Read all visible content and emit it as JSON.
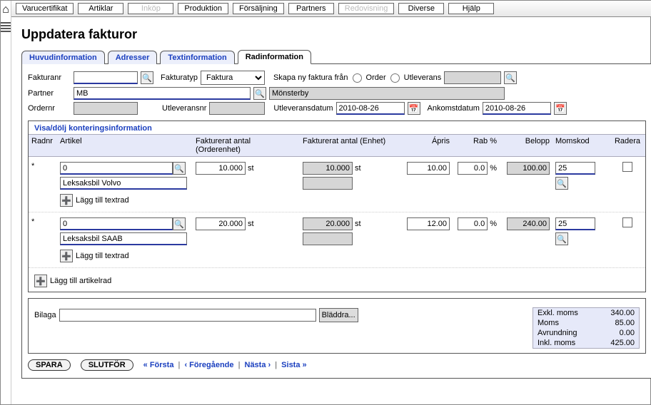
{
  "top_menu": [
    {
      "label": "Varucertifikat",
      "enabled": true
    },
    {
      "label": "Artiklar",
      "enabled": true
    },
    {
      "label": "Inköp",
      "enabled": false
    },
    {
      "label": "Produktion",
      "enabled": true
    },
    {
      "label": "Försäljning",
      "enabled": true
    },
    {
      "label": "Partners",
      "enabled": true
    },
    {
      "label": "Redovisning",
      "enabled": false
    },
    {
      "label": "Diverse",
      "enabled": true
    },
    {
      "label": "Hjälp",
      "enabled": true
    }
  ],
  "page_title": "Uppdatera fakturor",
  "tabs": [
    {
      "label": "Huvudinformation",
      "active": false
    },
    {
      "label": "Adresser",
      "active": false
    },
    {
      "label": "Textinformation",
      "active": false
    },
    {
      "label": "Radinformation",
      "active": true
    }
  ],
  "form": {
    "fakturanr_label": "Fakturanr",
    "fakturanr_value": "",
    "fakturatyp_label": "Fakturatyp",
    "fakturatyp_value": "Faktura",
    "skapa_label": "Skapa ny faktura från",
    "skapa_options": [
      "Order",
      "Utleverans"
    ],
    "skapa_lookup_value": "",
    "partner_label": "Partner",
    "partner_code": "MB",
    "partner_name": "Mönsterby",
    "ordernr_label": "Ordernr",
    "ordernr_value": "",
    "utlevnr_label": "Utleveransnr",
    "utlevnr_value": "",
    "utlevdatum_label": "Utleveransdatum",
    "utlevdatum_value": "2010-08-26",
    "ankomst_label": "Ankomstdatum",
    "ankomst_value": "2010-08-26"
  },
  "grid": {
    "toggle_label": "Visa/dölj konteringsinformation",
    "headers": {
      "radnr": "Radnr",
      "artikel": "Artikel",
      "faktord": "Fakturerat antal (Orderenhet)",
      "faktenh": "Fakturerat antal (Enhet)",
      "apris": "Ápris",
      "rab": "Rab %",
      "belopp": "Belopp",
      "momskod": "Momskod",
      "radera": "Radera"
    },
    "rows": [
      {
        "radnr": "*",
        "artikel_code": "0",
        "artikel_name": "Leksaksbil Volvo",
        "antal_order": "10.000",
        "order_unit": "st",
        "antal_enhet": "10.000",
        "enhet_unit": "st",
        "apris": "10.00",
        "rab": "0.0",
        "rab_unit": "%",
        "belopp": "100.00",
        "momskod": "25"
      },
      {
        "radnr": "*",
        "artikel_code": "0",
        "artikel_name": "Leksaksbil SAAB",
        "antal_order": "20.000",
        "order_unit": "st",
        "antal_enhet": "20.000",
        "enhet_unit": "st",
        "apris": "12.00",
        "rab": "0.0",
        "rab_unit": "%",
        "belopp": "240.00",
        "momskod": "25"
      }
    ],
    "add_textrow_label": "Lägg till textrad",
    "add_artikelrow_label": "Lägg till artikelrad"
  },
  "bilaga": {
    "label": "Bilaga",
    "value": "",
    "browse_label": "Bläddra..."
  },
  "totals": {
    "exkl_label": "Exkl. moms",
    "exkl_value": "340.00",
    "moms_label": "Moms",
    "moms_value": "85.00",
    "avr_label": "Avrundning",
    "avr_value": "0.00",
    "inkl_label": "Inkl. moms",
    "inkl_value": "425.00"
  },
  "footer": {
    "save": "SPARA",
    "finish": "SLUTFÖR",
    "first": "« Första",
    "prev": "‹ Föregående",
    "next": "Nästa ›",
    "last": "Sista »"
  }
}
